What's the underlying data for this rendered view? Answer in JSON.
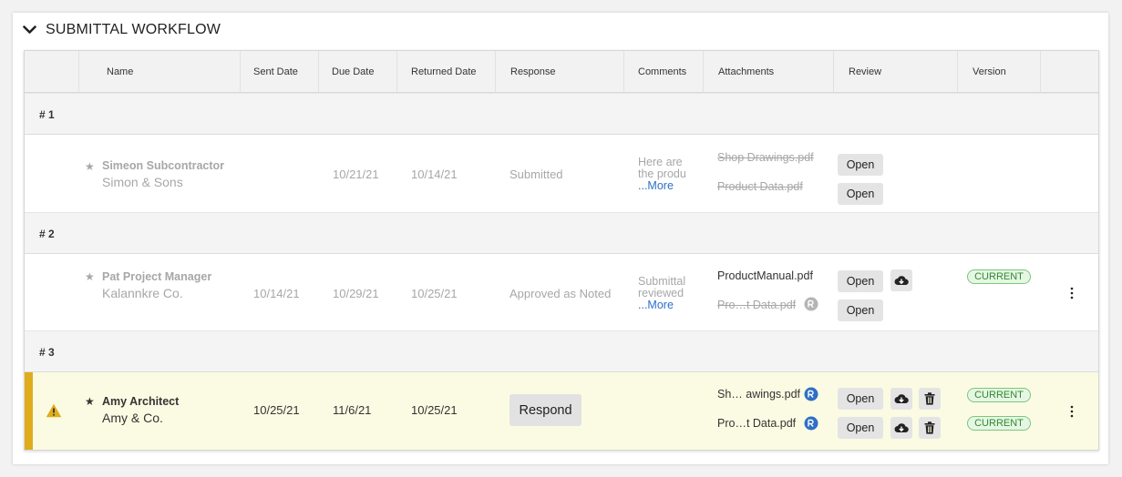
{
  "section": {
    "title": "SUBMITTAL WORKFLOW"
  },
  "columns": [
    "Name",
    "Sent Date",
    "Due Date",
    "Returned Date",
    "Response",
    "Comments",
    "Attachments",
    "Review",
    "Version"
  ],
  "groups": [
    {
      "label": "# 1",
      "row": {
        "name": "Simeon Subcontractor",
        "company": "Simon & Sons",
        "sent_date": "",
        "due_date": "10/21/21",
        "returned_date": "10/14/21",
        "response": "Submitted",
        "comment_text": [
          "Here are",
          "the produ"
        ],
        "comment_more": "...More",
        "attachments": [
          "Shop Drawings.pdf",
          "Product Data.pdf"
        ],
        "review_buttons": [
          "Open",
          "Open"
        ]
      }
    },
    {
      "label": "# 2",
      "row": {
        "name": "Pat Project Manager",
        "company": "Kalannkre Co.",
        "sent_date": "10/14/21",
        "due_date": "10/29/21",
        "returned_date": "10/25/21",
        "response": "Approved as Noted",
        "comment_text": [
          "Submittal",
          "reviewed"
        ],
        "comment_more": "...More",
        "attachments": [
          "ProductManual.pdf",
          "Pro…t Data.pdf"
        ],
        "review_buttons": [
          "Open",
          "Open"
        ],
        "version": "CURRENT"
      }
    },
    {
      "label": "# 3",
      "row": {
        "name": "Amy Architect",
        "company": "Amy & Co.",
        "sent_date": "10/25/21",
        "due_date": "11/6/21",
        "returned_date": "10/25/21",
        "response_button": "Respond",
        "attachments": [
          "Sh… awings.pdf",
          "Pro…t Data.pdf"
        ],
        "review_buttons": [
          "Open",
          "Open"
        ],
        "versions": [
          "CURRENT",
          "CURRENT"
        ]
      }
    }
  ],
  "icons": {
    "collapse": "chevron-down-icon",
    "star": "star-icon",
    "warning": "warning-icon",
    "download": "cloud-download-icon",
    "delete": "trash-icon",
    "markup": "markup-icon",
    "menu": "kebab-menu-icon"
  },
  "colors": {
    "accent": "#e0ac1b",
    "link": "#2f6fc7",
    "current_badge": "#2f8a2f",
    "highlight_row": "#fbfbe3"
  }
}
